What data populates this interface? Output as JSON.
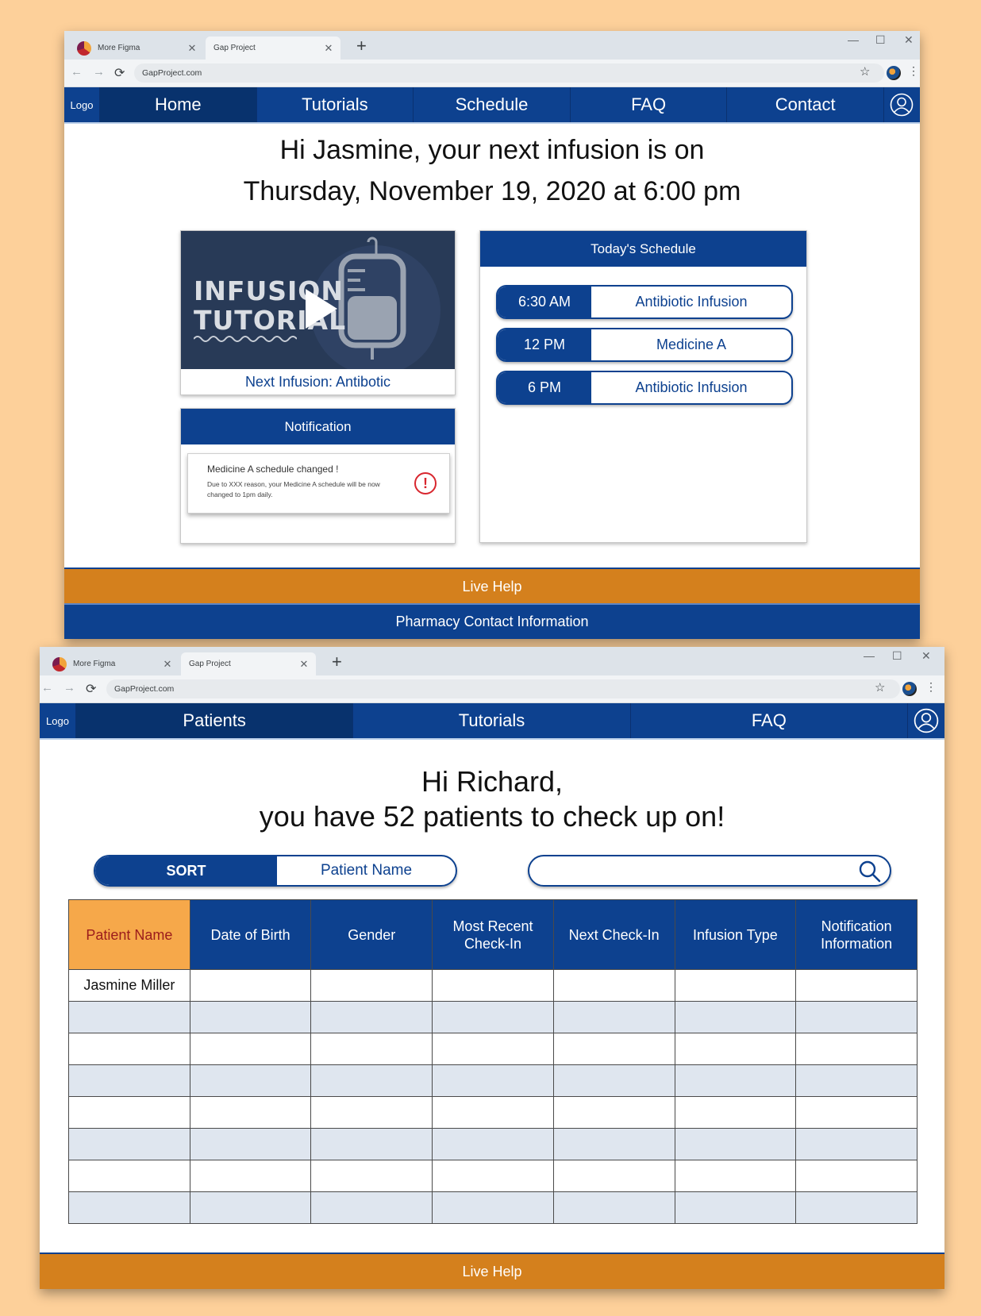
{
  "window1": {
    "tabs": [
      {
        "title": "More Figma",
        "close": "✕"
      },
      {
        "title": "Gap Project",
        "close": "✕"
      }
    ],
    "new_tab": "+",
    "controls": {
      "minimize": "—",
      "maximize": "☐",
      "close": "✕"
    },
    "url": "GapProject.com",
    "nav": {
      "logo": "Logo",
      "items": [
        "Home",
        "Tutorials",
        "Schedule",
        "FAQ",
        "Contact"
      ],
      "active": "Home"
    },
    "greeting": {
      "line1": "Hi Jasmine, your next infusion is on",
      "line2": "Thursday, November 19, 2020 at 6:00 pm"
    },
    "video": {
      "thumb_line1": "INFUSION",
      "thumb_line2": "TUTORIAL",
      "caption": "Next Infusion: Antibotic"
    },
    "notification": {
      "header": "Notification",
      "title": "Medicine A schedule changed !",
      "body": "Due to XXX reason, your Medicine A schedule will be now changed to 1pm daily.",
      "icon": "!"
    },
    "schedule": {
      "header": "Today's Schedule",
      "items": [
        {
          "time": "6:30 AM",
          "name": "Antibiotic Infusion"
        },
        {
          "time": "12 PM",
          "name": "Medicine A"
        },
        {
          "time": "6 PM",
          "name": "Antibiotic Infusion"
        }
      ]
    },
    "live_help": "Live Help",
    "pharmacy": "Pharmacy Contact Information"
  },
  "window2": {
    "tabs": [
      {
        "title": "More Figma",
        "close": "✕"
      },
      {
        "title": "Gap Project",
        "close": "✕"
      }
    ],
    "new_tab": "+",
    "controls": {
      "minimize": "—",
      "maximize": "☐",
      "close": "✕"
    },
    "url": "GapProject.com",
    "nav": {
      "logo": "Logo",
      "items": [
        "Patients",
        "Tutorials",
        "FAQ"
      ],
      "active": "Patients"
    },
    "greeting": {
      "line1": "Hi Richard,",
      "line2": "you have 52 patients to check up on!"
    },
    "sort": {
      "label": "SORT",
      "value": "Patient Name"
    },
    "search": {
      "value": "",
      "icon": "search-icon"
    },
    "table": {
      "columns": [
        "Patient Name",
        "Date of Birth",
        "Gender",
        "Most Recent Check-In",
        "Next Check-In",
        "Infusion Type",
        "Notification Information"
      ],
      "sorted_column": "Patient Name",
      "rows": [
        [
          "Jasmine Miller",
          "",
          "",
          "",
          "",
          "",
          ""
        ],
        [
          "",
          "",
          "",
          "",
          "",
          "",
          ""
        ],
        [
          "",
          "",
          "",
          "",
          "",
          "",
          ""
        ],
        [
          "",
          "",
          "",
          "",
          "",
          "",
          ""
        ],
        [
          "",
          "",
          "",
          "",
          "",
          "",
          ""
        ],
        [
          "",
          "",
          "",
          "",
          "",
          "",
          ""
        ],
        [
          "",
          "",
          "",
          "",
          "",
          "",
          ""
        ],
        [
          "",
          "",
          "",
          "",
          "",
          "",
          ""
        ]
      ]
    },
    "live_help": "Live Help"
  },
  "colors": {
    "background": "#fdd09a",
    "primary_blue": "#0d418f",
    "active_nav": "#08326d",
    "help_orange": "#d4801d",
    "sorted_header": "#f6a84a",
    "alert_red": "#d8262e"
  }
}
